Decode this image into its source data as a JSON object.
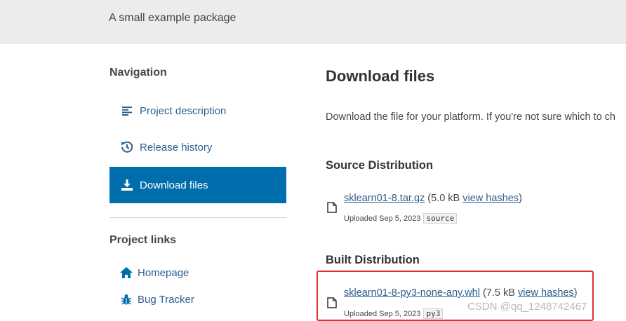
{
  "banner": {
    "summary": "A small example package"
  },
  "navigation": {
    "heading": "Navigation",
    "items": [
      {
        "label": "Project description",
        "icon": "align-left-icon",
        "active": false
      },
      {
        "label": "Release history",
        "icon": "history-icon",
        "active": false
      },
      {
        "label": "Download files",
        "icon": "download-icon",
        "active": true
      }
    ]
  },
  "project_links": {
    "heading": "Project links",
    "items": [
      {
        "label": "Homepage",
        "icon": "home-icon"
      },
      {
        "label": "Bug Tracker",
        "icon": "bug-icon"
      }
    ]
  },
  "main": {
    "title": "Download files",
    "description": "Download the file for your platform. If you're not sure which to ch",
    "source": {
      "heading": "Source Distribution",
      "filename": "sklearn01-8.tar.gz",
      "size": "(5.0 kB",
      "hashes_label": "view hashes",
      "close": ")",
      "uploaded": "Uploaded Sep 5, 2023",
      "tag": "source"
    },
    "built": {
      "heading": "Built Distribution",
      "filename": "sklearn01-8-py3-none-any.whl",
      "size": "(7.5 kB",
      "hashes_label": "view hashes",
      "close": ")",
      "uploaded": "Uploaded Sep 5, 2023",
      "tag": "py3"
    }
  },
  "watermark": "CSDN @qq_1248742467",
  "colors": {
    "accent": "#006dad",
    "link": "#2b5f8e",
    "highlight": "#e03030"
  }
}
